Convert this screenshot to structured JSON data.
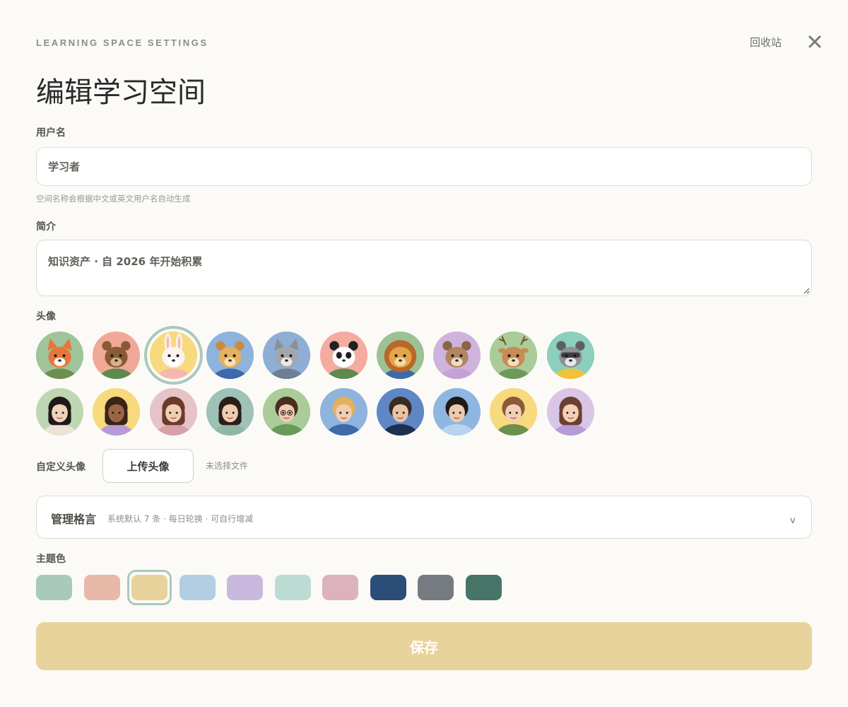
{
  "header": {
    "eyebrow": "LEARNING SPACE SETTINGS",
    "trash_label": "回收站",
    "close_icon": "close-icon",
    "title": "编辑学习空间"
  },
  "form": {
    "username_label": "用户名",
    "username_value": "学习者",
    "username_hint": "空间名称会根据中文或英文用户名自动生成",
    "bio_label": "简介",
    "bio_value": "知识资产 · 自 2026 年开始积累",
    "avatar_label": "头像",
    "selected_avatar": "bunny",
    "avatars": [
      {
        "id": "fox",
        "bg": "#9fc49a"
      },
      {
        "id": "bear",
        "bg": "#f0a999"
      },
      {
        "id": "bunny",
        "bg": "#f7d97e"
      },
      {
        "id": "dog",
        "bg": "#8eb3dd"
      },
      {
        "id": "cat",
        "bg": "#8eaed6"
      },
      {
        "id": "panda",
        "bg": "#f4aba0"
      },
      {
        "id": "lion",
        "bg": "#9cc194"
      },
      {
        "id": "owl",
        "bg": "#cfb3dc"
      },
      {
        "id": "deer",
        "bg": "#a9cc98"
      },
      {
        "id": "raccoon",
        "bg": "#8ccfbc"
      },
      {
        "id": "woman-long-hair",
        "bg": "#bfd6b2"
      },
      {
        "id": "woman-curly",
        "bg": "#f7d97e"
      },
      {
        "id": "woman-wavy",
        "bg": "#e6c3c9"
      },
      {
        "id": "woman-bob",
        "bg": "#9fc2b8"
      },
      {
        "id": "man-glasses",
        "bg": "#a9cc98"
      },
      {
        "id": "boy-blond",
        "bg": "#8eb3dd"
      },
      {
        "id": "man-suit",
        "bg": "#5f87c6"
      },
      {
        "id": "man-shirt",
        "bg": "#8fb6e0"
      },
      {
        "id": "child-boy",
        "bg": "#f7d97e"
      },
      {
        "id": "child-girl",
        "bg": "#d9c6e6"
      }
    ],
    "custom_avatar_label": "自定义头像",
    "upload_button": "上传头像",
    "no_file": "未选择文件",
    "quotes_title": "管理格言",
    "quotes_subtitle": "系统默认 7 条 · 每日轮换 · 可自行增减",
    "quotes_chevron": "v",
    "theme_label": "主题色",
    "selected_theme": "#e8d39c",
    "themes": [
      "#a9c9bb",
      "#e8b8a8",
      "#e8d39c",
      "#b3cde3",
      "#c9b8dd",
      "#bcdcd3",
      "#dcb2bd",
      "#2c4d78",
      "#767b82",
      "#467568"
    ],
    "save_button": "保存",
    "save_color": "#e8d39c"
  }
}
